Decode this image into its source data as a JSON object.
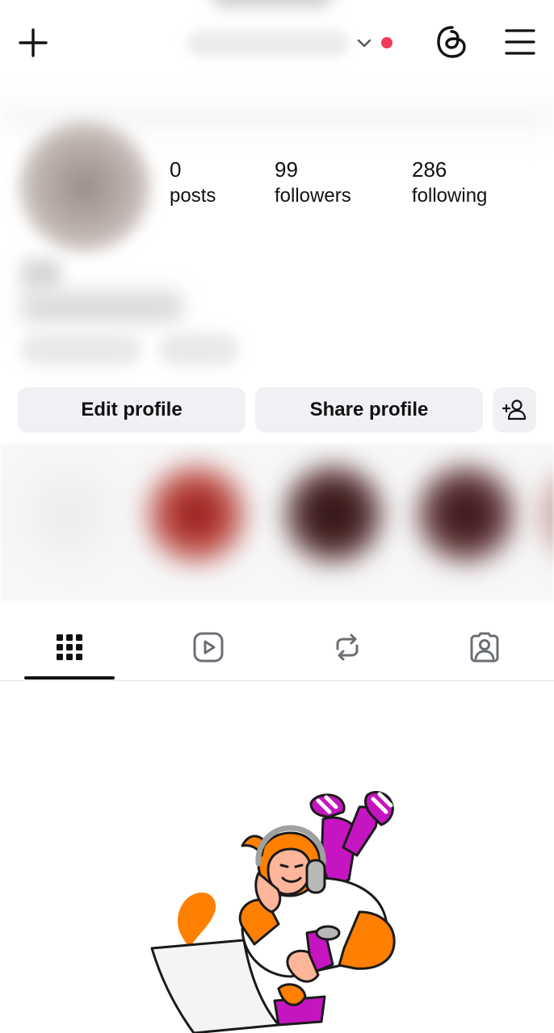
{
  "topbar": {
    "add_icon": "plus-icon",
    "switch_icon": "chevron-down-icon",
    "notification_color": "#ee3b56",
    "threads_icon": "threads-icon",
    "menu_icon": "hamburger-menu-icon"
  },
  "stats": {
    "posts": {
      "value": "0",
      "label": "posts"
    },
    "followers": {
      "value": "99",
      "label": "followers"
    },
    "following": {
      "value": "286",
      "label": "following"
    }
  },
  "actions": {
    "edit_label": "Edit profile",
    "share_label": "Share profile",
    "add_icon": "add-person-icon"
  },
  "tabs": [
    {
      "name": "grid",
      "icon": "grid-icon",
      "selected": true
    },
    {
      "name": "reels",
      "icon": "reels-icon",
      "selected": false
    },
    {
      "name": "reposts",
      "icon": "repost-icon",
      "selected": false
    },
    {
      "name": "tagged",
      "icon": "tagged-person-icon",
      "selected": false
    }
  ],
  "colors": {
    "accent_orange": "#ff7f00",
    "accent_magenta": "#c515c0",
    "button_bg": "#eff1f5"
  }
}
